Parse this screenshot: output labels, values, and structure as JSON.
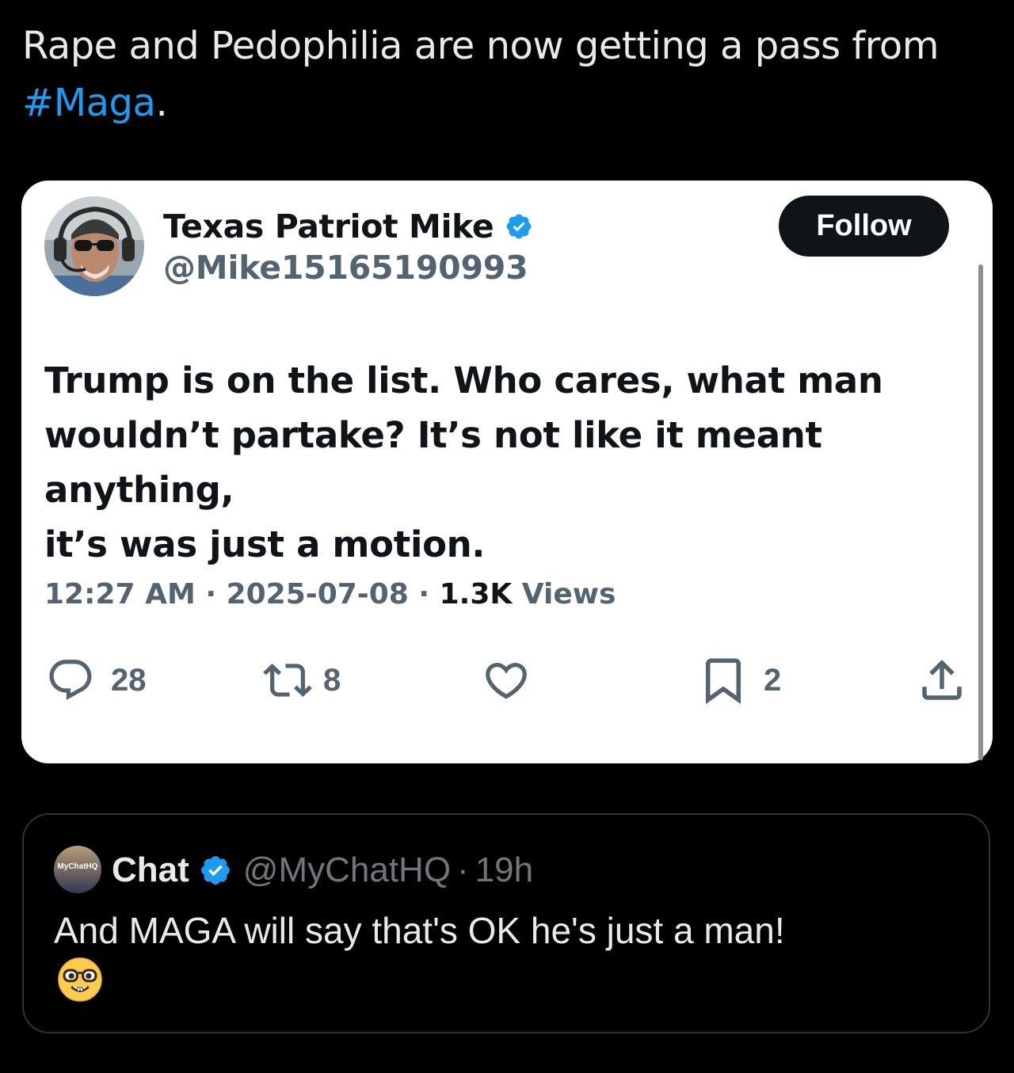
{
  "post": {
    "text_before": "Rape and Pedophilia are now getting a pass from ",
    "hashtag": "#Maga",
    "text_after": "."
  },
  "screenshot": {
    "author": {
      "display_name": "Texas Patriot Mike",
      "handle": "@Mike15165190993",
      "verified": true
    },
    "follow_label": "Follow",
    "body_lines": [
      "Trump is on the list.  Who cares, what man",
      "wouldn’t partake?  It’s not like it meant anything,",
      "it’s was just a motion."
    ],
    "meta": {
      "time": "12:27 AM",
      "sep1": " · ",
      "date": "2025-07-08",
      "sep2": " · ",
      "views_count": "1.3K",
      "views_label": " Views"
    },
    "actions": {
      "replies": "28",
      "reposts": "8",
      "likes": "",
      "bookmarks": "2"
    }
  },
  "reply": {
    "avatar_text": "MyChatHQ",
    "name": "Chat",
    "handle": "@MyChatHQ",
    "dot": "·",
    "time": "19h",
    "text": "And MAGA will say that's OK he's just a man!",
    "emoji": "nerd-face-emoji"
  },
  "colors": {
    "background": "#000000",
    "link": "#1d9bf0",
    "verified": "#1d9bf0",
    "muted": "#536471"
  }
}
